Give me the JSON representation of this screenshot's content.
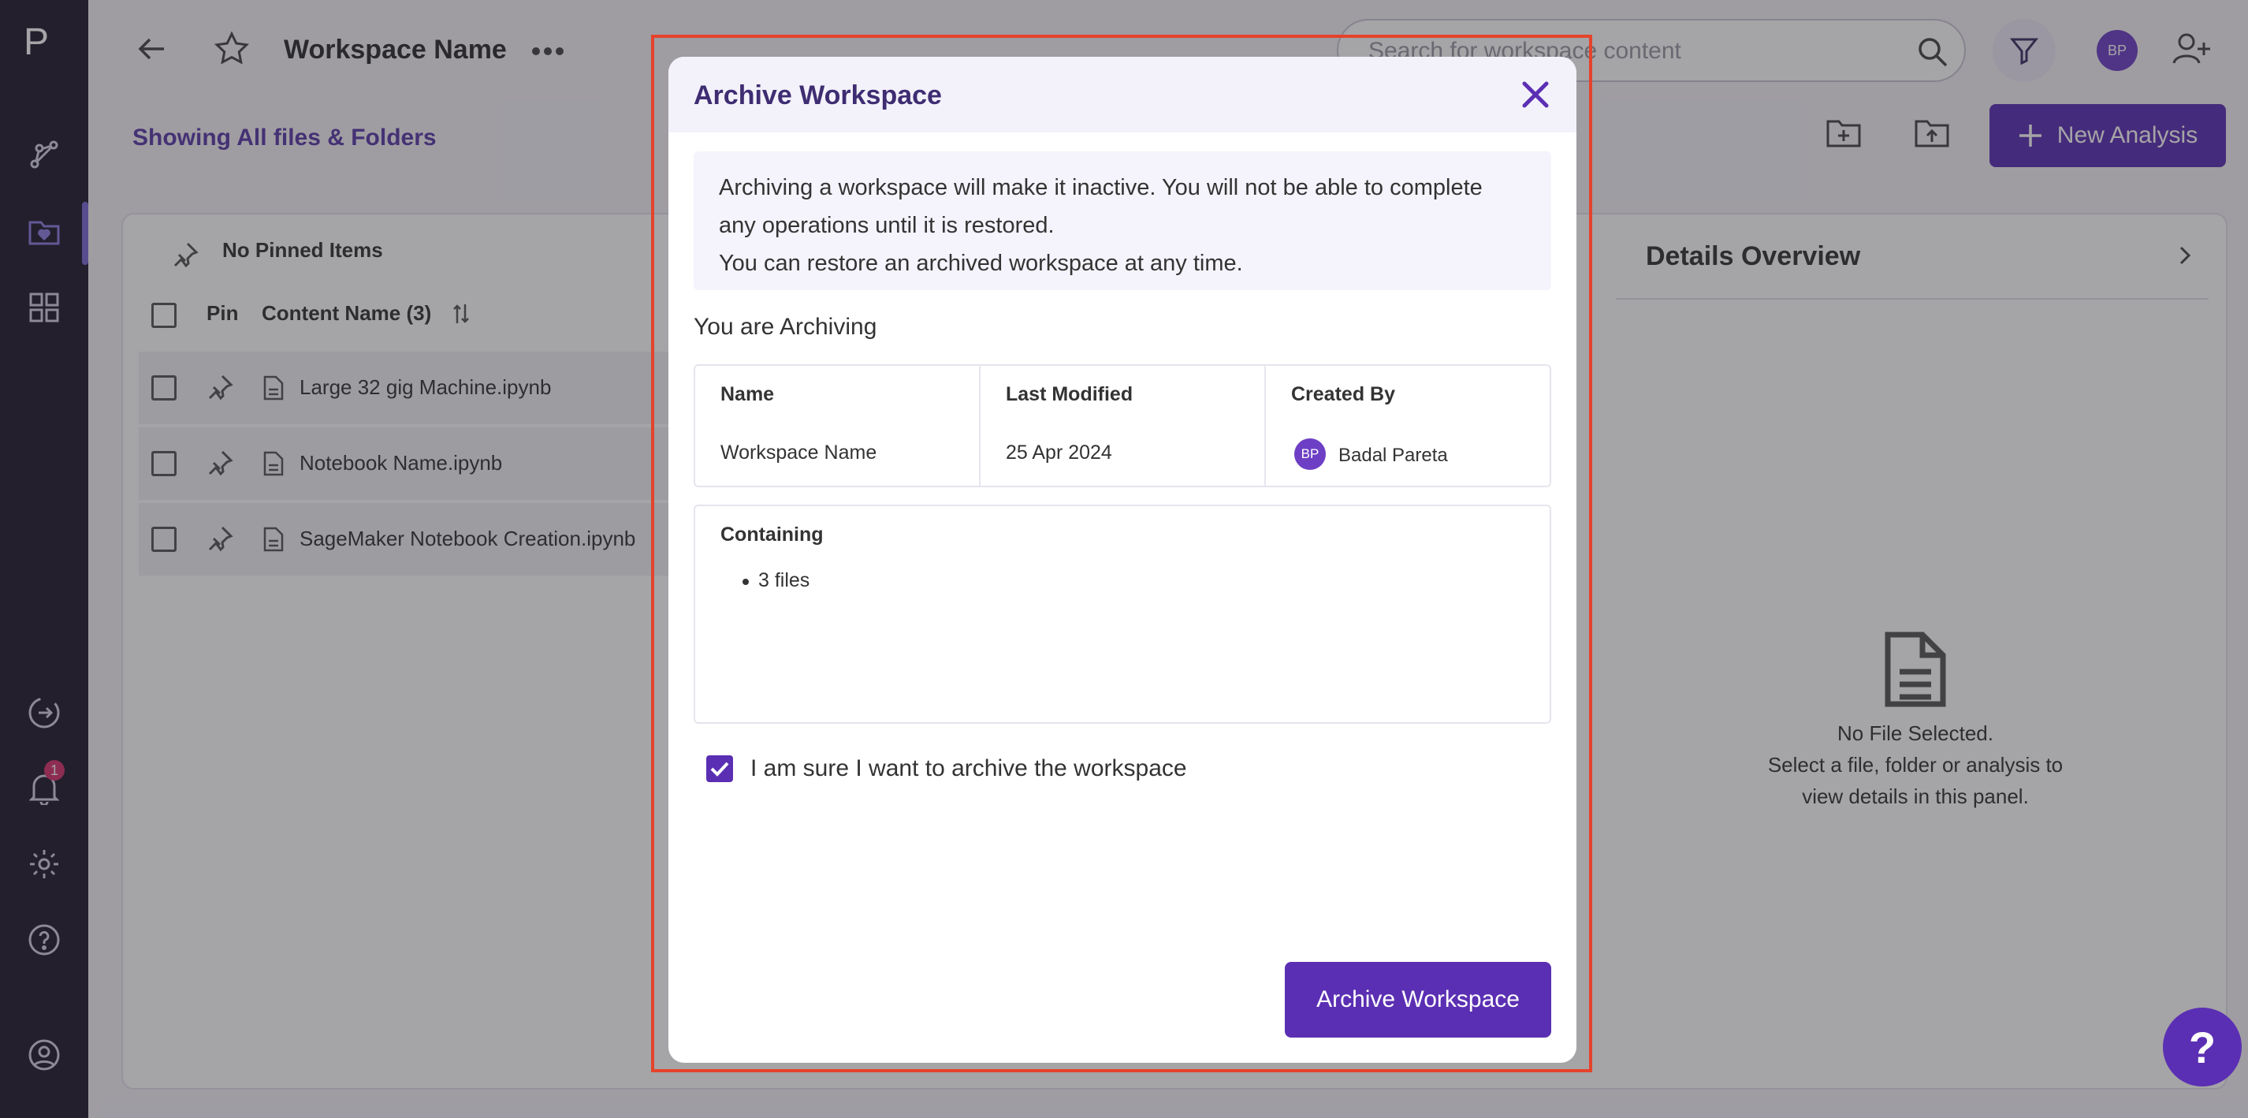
{
  "app": {
    "logo": "P"
  },
  "header": {
    "workspace_title": "Workspace Name",
    "search_placeholder": "Search for workspace content",
    "user_initials": "BP"
  },
  "subbar": {
    "showing_label": "Showing All files & Folders",
    "new_analysis_label": "New Analysis"
  },
  "nav": {
    "notification_count": "1"
  },
  "list": {
    "pinned_label": "No Pinned Items",
    "col_pin": "Pin",
    "col_content": "Content Name (3)",
    "rows": [
      {
        "name": "Large 32 gig Machine.ipynb"
      },
      {
        "name": "Notebook Name.ipynb"
      },
      {
        "name": "SageMaker Notebook Creation.ipynb"
      }
    ]
  },
  "details": {
    "title": "Details Overview",
    "empty_line1": "No File Selected.",
    "empty_line2": "Select a file, folder or analysis to",
    "empty_line3": "view details in this panel."
  },
  "modal": {
    "title": "Archive Workspace",
    "info_line1": "Archiving a workspace will make it inactive. You will not be able to complete",
    "info_line2": "any operations until it is restored.",
    "info_line3": "You can restore an archived workspace at any time.",
    "archiving_label": "You are Archiving",
    "meta": {
      "name_header": "Name",
      "name_value": "Workspace Name",
      "modified_header": "Last Modified",
      "modified_value": "25 Apr 2024",
      "created_header": "Created By",
      "created_initials": "BP",
      "created_value": "Badal Pareta"
    },
    "containing_header": "Containing",
    "containing_item": "3 files",
    "confirm_label": "I am sure I want to archive the workspace",
    "confirm_checked": true,
    "archive_button": "Archive Workspace"
  },
  "help_fab": "?",
  "colors": {
    "primary": "#5b2fb3",
    "highlight_border": "#e5432b",
    "nav_bg": "#1f1b2e"
  }
}
